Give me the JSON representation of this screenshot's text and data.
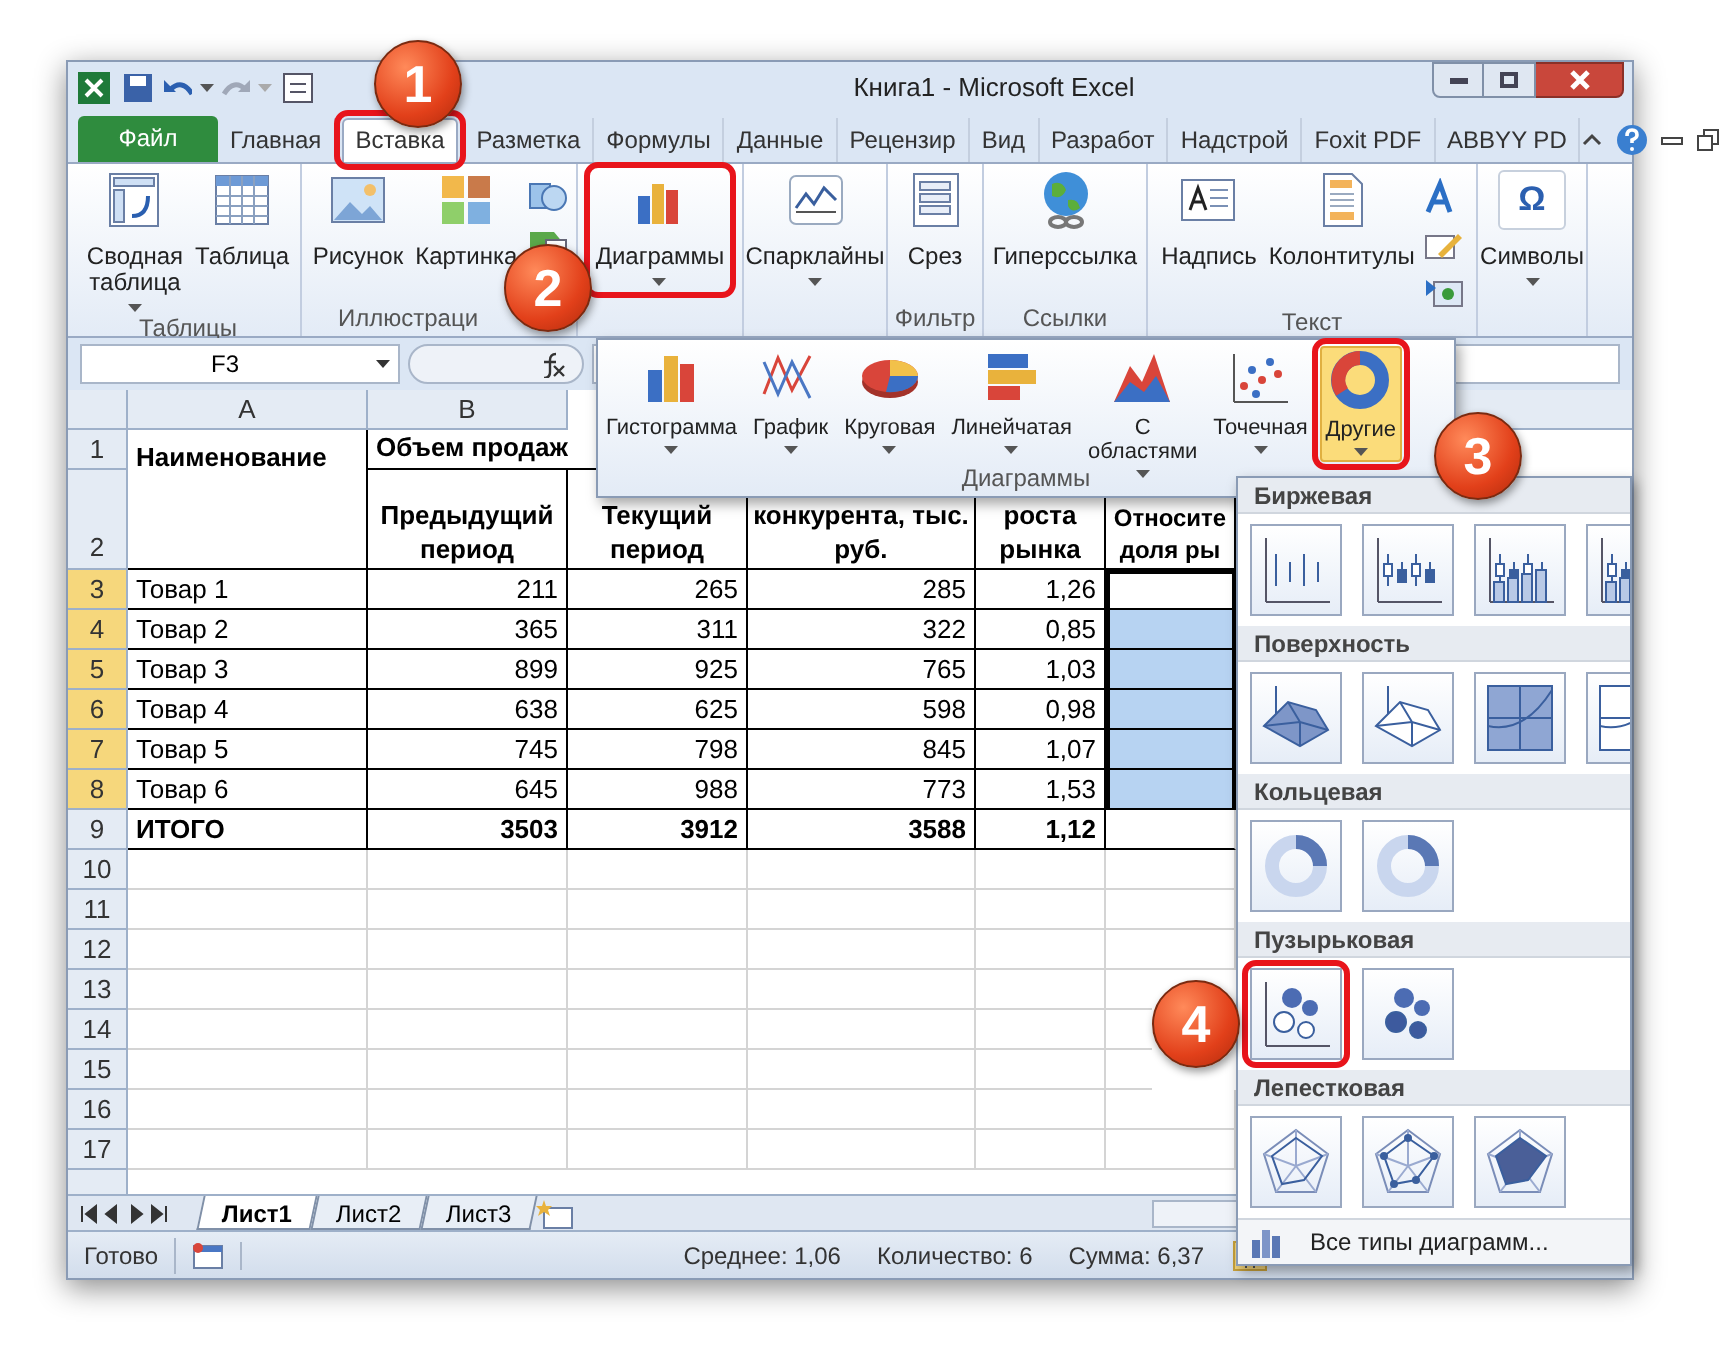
{
  "window": {
    "title": "Книга1 - Microsoft Excel"
  },
  "ribbon_tabs": [
    {
      "label": "Файл",
      "kind": "file",
      "selected": false,
      "highlighted": false
    },
    {
      "label": "Главная",
      "kind": "tab",
      "selected": false,
      "highlighted": false
    },
    {
      "label": "Вставка",
      "kind": "tab",
      "selected": true,
      "highlighted": true
    },
    {
      "label": "Разметка",
      "kind": "tab",
      "selected": false,
      "highlighted": false
    },
    {
      "label": "Формулы",
      "kind": "tab",
      "selected": false,
      "highlighted": false
    },
    {
      "label": "Данные",
      "kind": "tab",
      "selected": false,
      "highlighted": false
    },
    {
      "label": "Рецензир",
      "kind": "tab",
      "selected": false,
      "highlighted": false
    },
    {
      "label": "Вид",
      "kind": "tab",
      "selected": false,
      "highlighted": false
    },
    {
      "label": "Разработ",
      "kind": "tab",
      "selected": false,
      "highlighted": false
    },
    {
      "label": "Надстрой",
      "kind": "tab",
      "selected": false,
      "highlighted": false
    },
    {
      "label": "Foxit PDF",
      "kind": "tab",
      "selected": false,
      "highlighted": false
    },
    {
      "label": "ABBYY PD",
      "kind": "tab",
      "selected": false,
      "highlighted": false
    }
  ],
  "ribbon_groups": [
    {
      "label": "Таблицы",
      "buttons": [
        {
          "label": "Сводная\nтаблица",
          "dropdown": true,
          "highlighted": false
        },
        {
          "label": "Таблица",
          "dropdown": false,
          "highlighted": false
        }
      ]
    },
    {
      "label": "Иллюстраци",
      "buttons": [
        {
          "label": "Рисунок",
          "dropdown": false,
          "highlighted": false
        },
        {
          "label": "Картинка",
          "dropdown": false,
          "highlighted": false
        }
      ]
    },
    {
      "buttons": [
        {
          "label": "Диаграммы",
          "dropdown": true,
          "highlighted": true
        }
      ]
    },
    {
      "buttons": [
        {
          "label": "Спарклайны",
          "dropdown": true,
          "highlighted": false
        }
      ]
    },
    {
      "label": "Фильтр",
      "buttons": [
        {
          "label": "Срез",
          "dropdown": false,
          "highlighted": false
        }
      ]
    },
    {
      "label": "Ссылки",
      "buttons": [
        {
          "label": "Гиперссылка",
          "dropdown": false,
          "highlighted": false
        }
      ]
    },
    {
      "label": "Текст",
      "buttons": [
        {
          "label": "Надпись",
          "dropdown": false,
          "highlighted": false
        },
        {
          "label": "Колонтитулы",
          "dropdown": false,
          "highlighted": false
        }
      ]
    },
    {
      "buttons": [
        {
          "label": "Символы",
          "dropdown": true,
          "highlighted": false,
          "icon_char": "Ω"
        }
      ]
    }
  ],
  "formula_bar": {
    "name_box": "F3"
  },
  "sheet": {
    "column_headers": [
      "A",
      "B"
    ],
    "header": {
      "name": "Наименование",
      "group": "Объем продаж",
      "columns": [
        "Предыдущий\nпериод",
        "Текущий\nпериод",
        "конкурента, тыс.\nруб.",
        "роста\nрынка",
        "Относите\nдоля ры"
      ]
    },
    "rows": [
      {
        "number": "1",
        "kind": "header",
        "selected": false
      },
      {
        "number": "2",
        "kind": "header",
        "selected": false
      },
      {
        "number": "3",
        "kind": "data",
        "selected": true,
        "cells": [
          "Товар 1",
          "211",
          "265",
          "285",
          "1,26"
        ],
        "share": {
          "selected": true,
          "active": true
        }
      },
      {
        "number": "4",
        "kind": "data",
        "selected": true,
        "cells": [
          "Товар 2",
          "365",
          "311",
          "322",
          "0,85"
        ],
        "share": {
          "selected": true,
          "active": false
        }
      },
      {
        "number": "5",
        "kind": "data",
        "selected": true,
        "cells": [
          "Товар 3",
          "899",
          "925",
          "765",
          "1,03"
        ],
        "share": {
          "selected": true,
          "active": false
        }
      },
      {
        "number": "6",
        "kind": "data",
        "selected": true,
        "cells": [
          "Товар 4",
          "638",
          "625",
          "598",
          "0,98"
        ],
        "share": {
          "selected": true,
          "active": false
        }
      },
      {
        "number": "7",
        "kind": "data",
        "selected": true,
        "cells": [
          "Товар 5",
          "745",
          "798",
          "845",
          "1,07"
        ],
        "share": {
          "selected": true,
          "active": false
        }
      },
      {
        "number": "8",
        "kind": "data",
        "selected": true,
        "cells": [
          "Товар 6",
          "645",
          "988",
          "773",
          "1,53"
        ],
        "share": {
          "selected": true,
          "active": false
        }
      },
      {
        "number": "9",
        "kind": "total",
        "selected": false,
        "cells": [
          "ИТОГО",
          "3503",
          "3912",
          "3588",
          "1,12"
        ],
        "share": {
          "selected": false,
          "active": false
        }
      },
      {
        "number": "10",
        "kind": "empty",
        "selected": false
      },
      {
        "number": "11",
        "kind": "empty",
        "selected": false
      },
      {
        "number": "12",
        "kind": "empty",
        "selected": false
      },
      {
        "number": "13",
        "kind": "empty",
        "selected": false
      },
      {
        "number": "14",
        "kind": "empty",
        "selected": false
      },
      {
        "number": "15",
        "kind": "empty",
        "selected": false
      },
      {
        "number": "16",
        "kind": "empty",
        "selected": false
      },
      {
        "number": "17",
        "kind": "empty",
        "selected": false
      }
    ]
  },
  "sheet_tabs": [
    {
      "label": "Лист1",
      "selected": true
    },
    {
      "label": "Лист2",
      "selected": false
    },
    {
      "label": "Лист3",
      "selected": false
    }
  ],
  "status_bar": {
    "state": "Готово",
    "average": "Среднее: 1,06",
    "count": "Количество: 6",
    "sum": "Сумма: 6,37"
  },
  "charts_menu": {
    "label": "Диаграммы",
    "items": [
      {
        "label": "Гистограмма",
        "selected": false,
        "highlighted": false
      },
      {
        "label": "График",
        "selected": false,
        "highlighted": false
      },
      {
        "label": "Круговая",
        "selected": false,
        "highlighted": false
      },
      {
        "label": "Линейчатая",
        "selected": false,
        "highlighted": false
      },
      {
        "label": "С\nобластями",
        "selected": false,
        "highlighted": false
      },
      {
        "label": "Точечная",
        "selected": false,
        "highlighted": false
      },
      {
        "label": "Другие",
        "selected": true,
        "highlighted": true
      }
    ]
  },
  "gallery": {
    "sections": [
      {
        "title": "Биржевая",
        "kind": "stock",
        "thumbnails": [
          {
            "highlighted": false
          },
          {
            "highlighted": false
          },
          {
            "highlighted": false
          },
          {
            "highlighted": false
          }
        ]
      },
      {
        "title": "Поверхность",
        "kind": "surface",
        "thumbnails": [
          {
            "highlighted": false
          },
          {
            "highlighted": false
          },
          {
            "highlighted": false
          },
          {
            "highlighted": false
          }
        ]
      },
      {
        "title": "Кольцевая",
        "kind": "doughnut",
        "thumbnails": [
          {
            "highlighted": false
          },
          {
            "highlighted": false
          }
        ]
      },
      {
        "title": "Пузырьковая",
        "kind": "bubble",
        "thumbnails": [
          {
            "highlighted": true
          },
          {
            "highlighted": false
          }
        ]
      },
      {
        "title": "Лепестковая",
        "kind": "radar",
        "thumbnails": [
          {
            "highlighted": false
          },
          {
            "highlighted": false
          },
          {
            "highlighted": false
          }
        ]
      }
    ],
    "footer": "Все типы диаграмм..."
  },
  "callouts": [
    {
      "label": "1"
    },
    {
      "label": "2"
    },
    {
      "label": "3"
    },
    {
      "label": "4"
    }
  ]
}
